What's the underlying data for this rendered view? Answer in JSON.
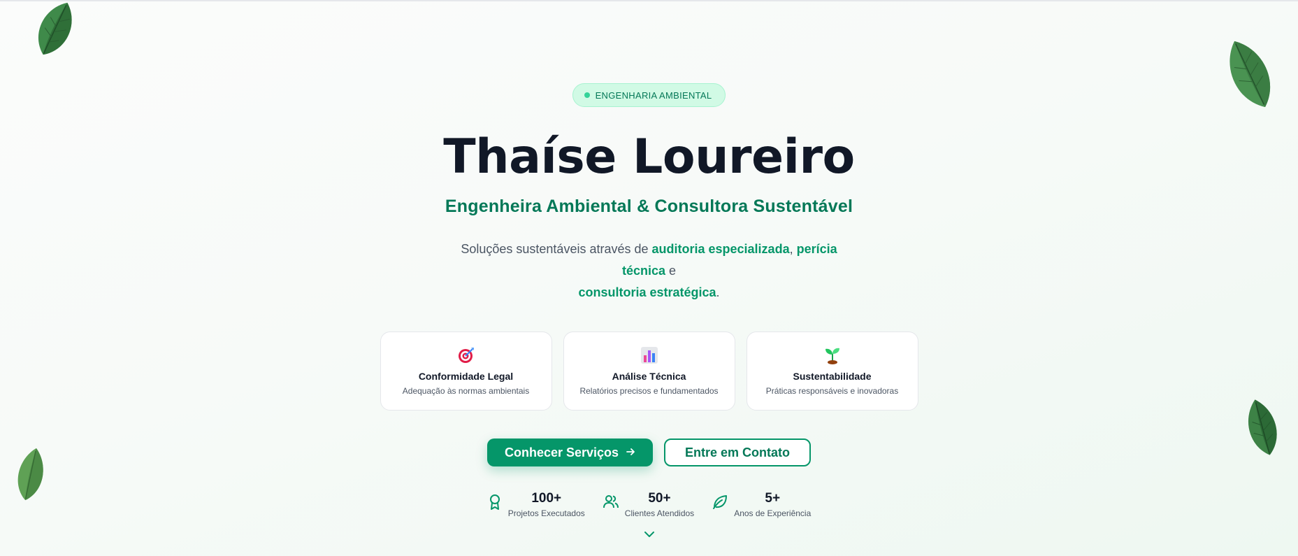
{
  "hero": {
    "badge": "ENGENHARIA AMBIENTAL",
    "title": "Thaíse Loureiro",
    "subtitle": "Engenheira Ambiental & Consultora Sustentável",
    "description": {
      "part1": "Soluções sustentáveis através de ",
      "highlight1": "auditoria especializada",
      "part2": ", ",
      "highlight2": "perícia técnica",
      "part3": " e ",
      "highlight3": "consultoria estratégica",
      "part4": "."
    }
  },
  "features": [
    {
      "icon": "target-icon",
      "title": "Conformidade Legal",
      "description": "Adequação às normas ambientais"
    },
    {
      "icon": "bar-chart-icon",
      "title": "Análise Técnica",
      "description": "Relatórios precisos e fundamentados"
    },
    {
      "icon": "seedling-icon",
      "title": "Sustentabilidade",
      "description": "Práticas responsáveis e inovadoras"
    }
  ],
  "buttons": {
    "primary": "Conhecer Serviços",
    "secondary": "Entre em Contato"
  },
  "stats": [
    {
      "icon": "award-icon",
      "value": "100+",
      "label": "Projetos Executados"
    },
    {
      "icon": "users-icon",
      "value": "50+",
      "label": "Clientes Atendidos"
    },
    {
      "icon": "leaf-icon",
      "value": "5+",
      "label": "Anos de Experiência"
    }
  ],
  "colors": {
    "accent": "#059669",
    "accent_dark": "#047857",
    "badge_bg": "#d1fae5",
    "title": "#111827",
    "leaf": "#3f8a4a"
  }
}
